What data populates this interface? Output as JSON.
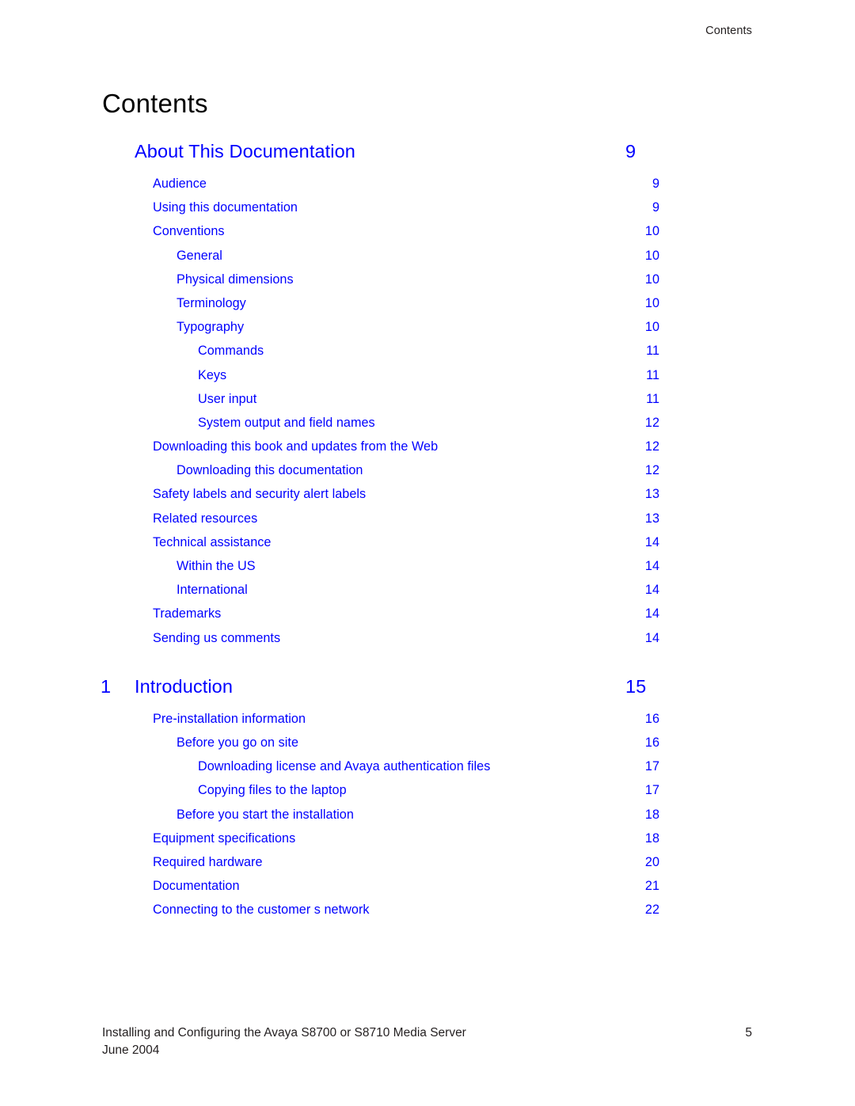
{
  "header": {
    "running_title": "Contents"
  },
  "page_title": "Contents",
  "toc": {
    "entries": [
      {
        "kind": "chapter",
        "number": "",
        "label": "About This Documentation",
        "page": "9"
      },
      {
        "kind": "entry",
        "level": 1,
        "label": "Audience",
        "page": "9"
      },
      {
        "kind": "entry",
        "level": 1,
        "label": "Using this documentation",
        "page": "9"
      },
      {
        "kind": "entry",
        "level": 1,
        "label": "Conventions",
        "page": "10"
      },
      {
        "kind": "entry",
        "level": 2,
        "label": "General",
        "page": "10"
      },
      {
        "kind": "entry",
        "level": 2,
        "label": "Physical dimensions",
        "page": "10"
      },
      {
        "kind": "entry",
        "level": 2,
        "label": "Terminology",
        "page": "10"
      },
      {
        "kind": "entry",
        "level": 2,
        "label": "Typography",
        "page": "10"
      },
      {
        "kind": "entry",
        "level": 3,
        "label": "Commands",
        "page": "11"
      },
      {
        "kind": "entry",
        "level": 3,
        "label": "Keys",
        "page": "11"
      },
      {
        "kind": "entry",
        "level": 3,
        "label": "User input",
        "page": "11"
      },
      {
        "kind": "entry",
        "level": 3,
        "label": "System output and field names",
        "page": "12"
      },
      {
        "kind": "entry",
        "level": 1,
        "label": "Downloading this book and updates from the Web",
        "page": "12"
      },
      {
        "kind": "entry",
        "level": 2,
        "label": "Downloading this documentation",
        "page": "12"
      },
      {
        "kind": "entry",
        "level": 1,
        "label": "Safety labels and security alert labels",
        "page": "13"
      },
      {
        "kind": "entry",
        "level": 1,
        "label": "Related resources",
        "page": "13"
      },
      {
        "kind": "entry",
        "level": 1,
        "label": "Technical assistance",
        "page": "14"
      },
      {
        "kind": "entry",
        "level": 2,
        "label": "Within the US",
        "page": "14"
      },
      {
        "kind": "entry",
        "level": 2,
        "label": "International",
        "page": "14"
      },
      {
        "kind": "entry",
        "level": 1,
        "label": "Trademarks",
        "page": "14"
      },
      {
        "kind": "entry",
        "level": 1,
        "label": "Sending us comments",
        "page": "14"
      },
      {
        "kind": "chapter",
        "number": "1",
        "label": "Introduction",
        "page": "15"
      },
      {
        "kind": "entry",
        "level": 1,
        "label": "Pre-installation information",
        "page": "16"
      },
      {
        "kind": "entry",
        "level": 2,
        "label": "Before you go on site",
        "page": "16"
      },
      {
        "kind": "entry",
        "level": 3,
        "label": "Downloading license and Avaya authentication files",
        "page": "17"
      },
      {
        "kind": "entry",
        "level": 3,
        "label": "Copying files to the laptop",
        "page": "17"
      },
      {
        "kind": "entry",
        "level": 2,
        "label": "Before you start the installation",
        "page": "18"
      },
      {
        "kind": "entry",
        "level": 1,
        "label": "Equipment specifications",
        "page": "18"
      },
      {
        "kind": "entry",
        "level": 1,
        "label": "Required hardware",
        "page": "20"
      },
      {
        "kind": "entry",
        "level": 1,
        "label": "Documentation",
        "page": "21"
      },
      {
        "kind": "entry",
        "level": 1,
        "label": "Connecting to the customer s network",
        "page": "22"
      }
    ]
  },
  "footer": {
    "book_title": "Installing and Configuring the Avaya S8700 or S8710 Media Server",
    "date": "June 2004",
    "page_number": "5"
  }
}
